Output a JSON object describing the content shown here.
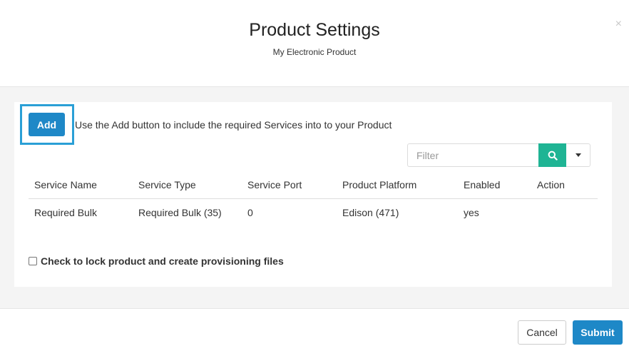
{
  "header": {
    "title": "Product Settings",
    "subtitle": "My Electronic Product",
    "close_label": "×"
  },
  "toolbar": {
    "add_label": "Add",
    "add_hint": "Use the Add button to include the required Services into to your Product"
  },
  "filter": {
    "placeholder": "Filter",
    "search_icon": "search-icon",
    "dropdown_icon": "caret-down-icon"
  },
  "table": {
    "columns": [
      "Service Name",
      "Service Type",
      "Service Port",
      "Product Platform",
      "Enabled",
      "Action"
    ],
    "rows": [
      [
        "Required Bulk",
        "Required Bulk (35)",
        "0",
        "Edison (471)",
        "yes",
        ""
      ]
    ]
  },
  "lock": {
    "label": "Check to lock product and create provisioning files",
    "checked": false
  },
  "footer": {
    "cancel_label": "Cancel",
    "submit_label": "Submit"
  },
  "colors": {
    "primary": "#1e88c7",
    "search": "#1fb494",
    "highlight": "#2a9fd6"
  }
}
